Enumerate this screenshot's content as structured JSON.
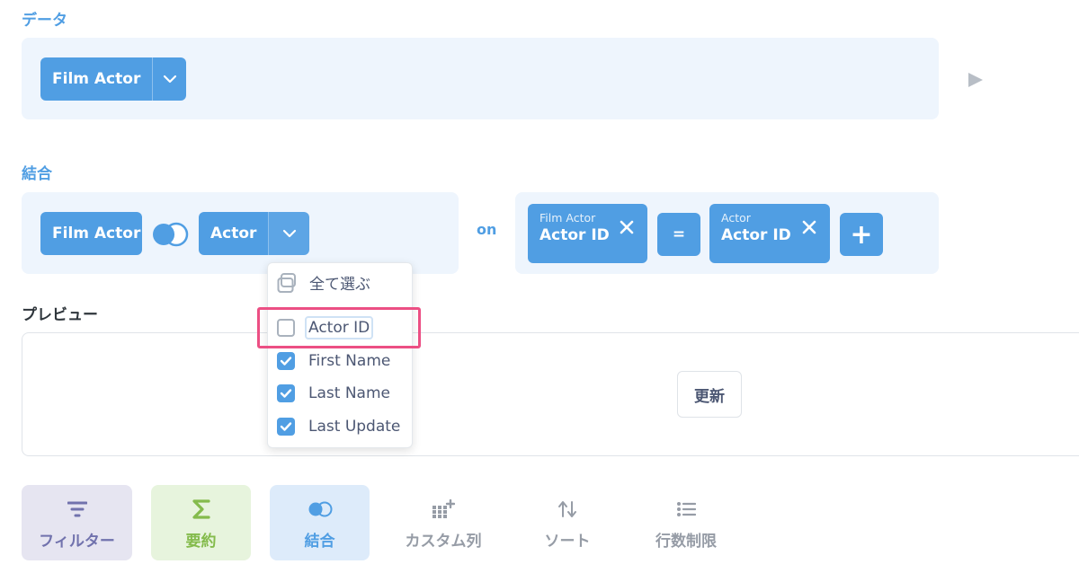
{
  "data_section": {
    "title": "データ",
    "table_label": "Film Actor"
  },
  "join_section": {
    "title": "結合",
    "left_table": "Film Actor",
    "right_table": "Actor",
    "on_label": "on",
    "left_condition": {
      "table": "Film Actor",
      "column": "Actor ID"
    },
    "operator": "=",
    "right_condition": {
      "table": "Actor",
      "column": "Actor ID"
    },
    "add_label": "+"
  },
  "column_dropdown": {
    "select_all": "全て選ぶ",
    "items": [
      {
        "label": "Actor ID",
        "checked": false
      },
      {
        "label": "First Name",
        "checked": true
      },
      {
        "label": "Last Name",
        "checked": true
      },
      {
        "label": "Last Update",
        "checked": true
      }
    ]
  },
  "preview_section": {
    "title": "プレビュー",
    "refresh_label": "更新"
  },
  "steps": [
    {
      "label": "フィルター",
      "icon": "filter-icon"
    },
    {
      "label": "要約",
      "icon": "sigma-icon"
    },
    {
      "label": "結合",
      "icon": "join-icon"
    },
    {
      "label": "カスタム列",
      "icon": "custom-column-icon"
    },
    {
      "label": "ソート",
      "icon": "sort-icon"
    },
    {
      "label": "行数制限",
      "icon": "list-icon"
    }
  ],
  "colors": {
    "brand": "#509ee3",
    "panel_bg": "#eef5fd",
    "filter_bg": "#e6e5f1",
    "filter_text": "#7172ad",
    "summarize_bg": "#e7f4dd",
    "summarize_text": "#84bb4c",
    "join_bg": "#ddebfa",
    "highlight": "#ec4f84"
  }
}
